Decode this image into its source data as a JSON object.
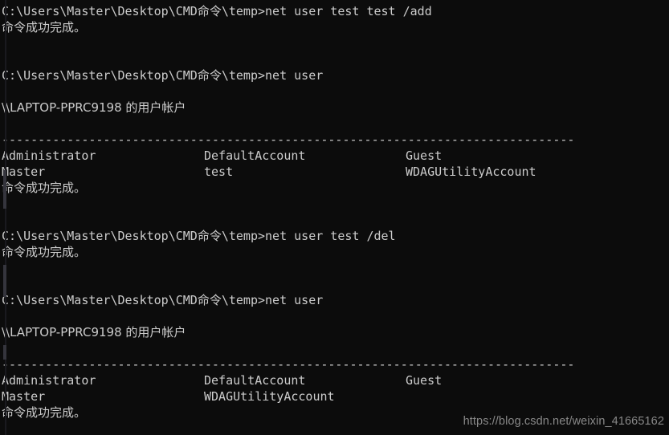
{
  "terminal": {
    "app": "Command Prompt",
    "background_color": "#0c0c0c",
    "text_color": "#cccccc",
    "prompt": "C:\\Users\\Master\\Desktop\\CMD命令\\temp>",
    "machine": "\\\\LAPTOP-PPRC9198",
    "success_message": "命令成功完成。",
    "accounts_heading_suffix": " 的用户帐户",
    "separator": "-------------------------------------------------------------------------------",
    "blocks": [
      {
        "id": "block-1",
        "command_line": "C:\\Users\\Master\\Desktop\\CMD命令\\temp>net user test test /add",
        "command": "net user test test /add",
        "result": "命令成功完成。"
      },
      {
        "id": "block-2",
        "command_line": "C:\\Users\\Master\\Desktop\\CMD命令\\temp>net user",
        "command": "net user",
        "heading": "\\\\LAPTOP-PPRC9198 的用户帐户",
        "separator": "-------------------------------------------------------------------------------",
        "user_rows": [
          [
            "Administrator",
            "DefaultAccount",
            "Guest"
          ],
          [
            "Master",
            "test",
            "WDAGUtilityAccount"
          ]
        ],
        "result": "命令成功完成。"
      },
      {
        "id": "block-3",
        "command_line": "C:\\Users\\Master\\Desktop\\CMD命令\\temp>net user test /del",
        "command": "net user test /del",
        "result": "命令成功完成。"
      },
      {
        "id": "block-4",
        "command_line": "C:\\Users\\Master\\Desktop\\CMD命令\\temp>net user",
        "command": "net user",
        "heading": "\\\\LAPTOP-PPRC9198 的用户帐户",
        "separator": "-------------------------------------------------------------------------------",
        "user_rows": [
          [
            "Administrator",
            "DefaultAccount",
            "Guest"
          ],
          [
            "Master",
            "WDAGUtilityAccount",
            ""
          ]
        ],
        "result": "命令成功完成。"
      }
    ]
  },
  "watermark": {
    "text": "https://blog.csdn.net/weixin_41665162",
    "color": "#9a9a9a"
  }
}
